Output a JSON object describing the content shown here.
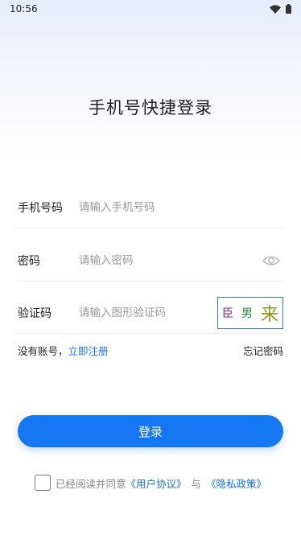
{
  "status_bar": {
    "time": "10:56"
  },
  "title": "手机号快捷登录",
  "fields": {
    "phone": {
      "label": "手机号码",
      "placeholder": "请输入手机号码"
    },
    "password": {
      "label": "密码",
      "placeholder": "请输入密码"
    },
    "captcha": {
      "label": "验证码",
      "placeholder": "请输入图形验证码",
      "image_chars": [
        "臣",
        "男",
        "来"
      ]
    }
  },
  "links": {
    "no_account": "没有账号，",
    "register": "立即注册",
    "forgot": "忘记密码"
  },
  "login_button": "登录",
  "agreement": {
    "prefix": "已经阅读并同意",
    "user_agreement": "《用户协议》",
    "and": "与",
    "privacy_policy": "《隐私政策》"
  },
  "colors": {
    "primary": "#1677f5",
    "link": "#1a73e8"
  },
  "icons": {
    "wifi": "wifi-icon",
    "battery": "battery-icon",
    "eye": "eye-icon"
  }
}
